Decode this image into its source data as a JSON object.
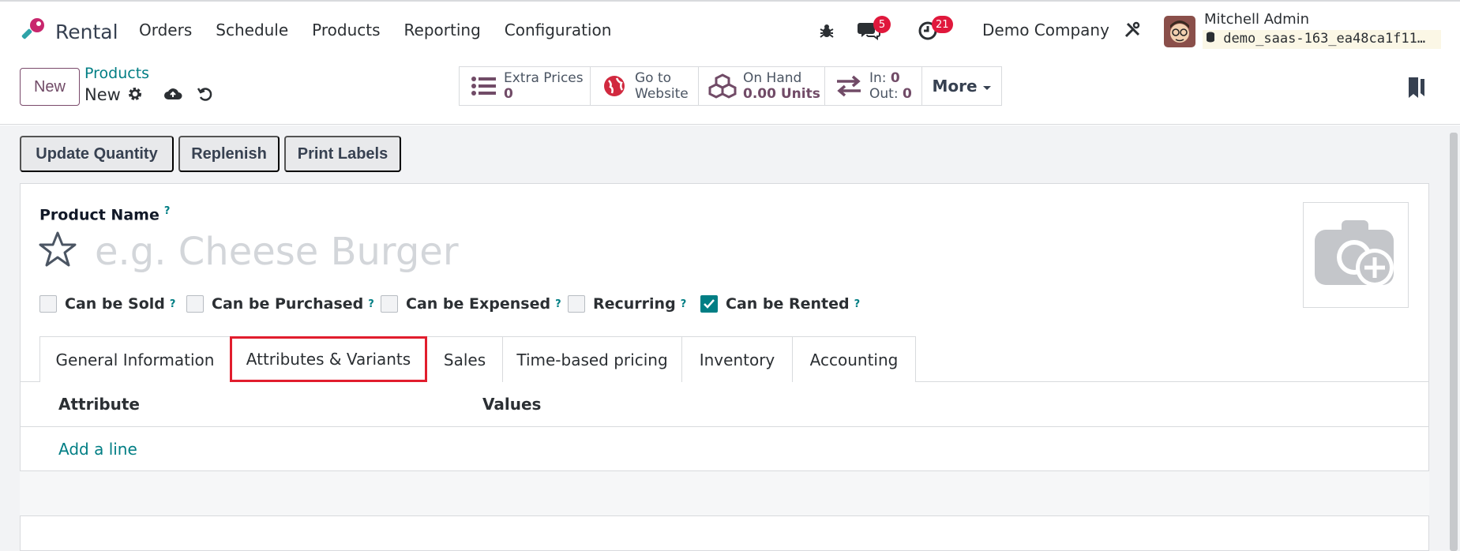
{
  "app": {
    "name": "Rental"
  },
  "menu": [
    "Orders",
    "Schedule",
    "Products",
    "Reporting",
    "Configuration"
  ],
  "systray": {
    "messages_count": "5",
    "activities_count": "21",
    "company": "Demo Company",
    "user_name": "Mitchell Admin",
    "database": "demo_saas-163_ea48ca1f11…"
  },
  "control": {
    "new_label": "New",
    "breadcrumb_parent": "Products",
    "breadcrumb_current": "New"
  },
  "smart_buttons": {
    "extra_prices": {
      "label": "Extra Prices",
      "value": "0"
    },
    "website": {
      "line1": "Go to",
      "line2": "Website"
    },
    "on_hand": {
      "label": "On Hand",
      "value": "0.00 Units"
    },
    "moves": {
      "in": "In:",
      "in_value": "0",
      "out": "Out:",
      "out_value": "0"
    },
    "more": "More"
  },
  "actions": [
    "Update Quantity",
    "Replenish",
    "Print Labels"
  ],
  "form": {
    "product_name_label": "Product Name",
    "help_mark": "?",
    "name_placeholder": "e.g. Cheese Burger",
    "checkboxes": [
      {
        "label": "Can be Sold",
        "checked": false
      },
      {
        "label": "Can be Purchased",
        "checked": false
      },
      {
        "label": "Can be Expensed",
        "checked": false
      },
      {
        "label": "Recurring",
        "checked": false
      },
      {
        "label": "Can be Rented",
        "checked": true
      }
    ]
  },
  "tabs": [
    "General Information",
    "Attributes & Variants",
    "Sales",
    "Time-based pricing",
    "Inventory",
    "Accounting"
  ],
  "active_tab": "Attributes & Variants",
  "table": {
    "headers": [
      "Attribute",
      "Values"
    ],
    "add_line": "Add a line"
  },
  "colors": {
    "brand": "#714b67",
    "accent": "#017e84",
    "highlight": "#e11d2d"
  }
}
